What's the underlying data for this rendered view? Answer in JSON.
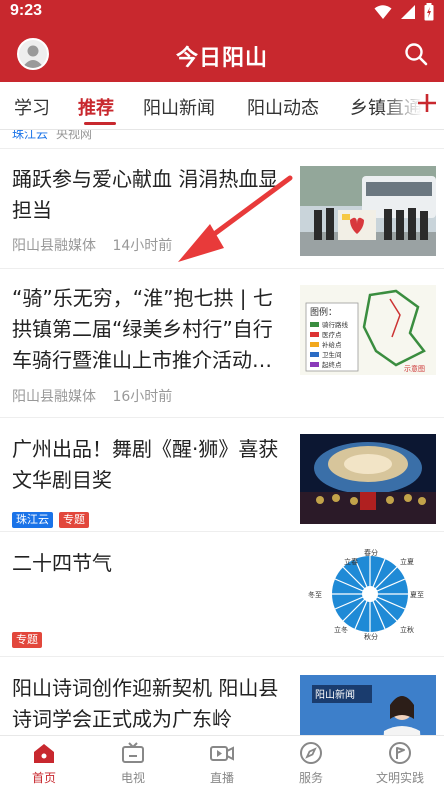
{
  "status": {
    "time": "9:23"
  },
  "header": {
    "title": "今日阳山"
  },
  "tabs": [
    {
      "label": "学习"
    },
    {
      "label": "推荐"
    },
    {
      "label": "阳山新闻"
    },
    {
      "label": "阳山动态"
    },
    {
      "label": "乡镇直通"
    }
  ],
  "cut_item": {
    "tag": "珠江云",
    "source": "央视网"
  },
  "articles": [
    {
      "title": "踊跃参与爱心献血 涓涓热血显担当",
      "source": "阳山县融媒体",
      "time": "14小时前"
    },
    {
      "title": "“骑”乐无穷，“淮”抱七拱 | 七拱镇第二届“绿美乡村行”自行车骑行暨淮山上市推介活动…",
      "source": "阳山县融媒体",
      "time": "16小时前",
      "map_legend": "图例：",
      "map_items": [
        "骑行路线",
        "医疗点",
        "补给点",
        "卫生间",
        "起终点"
      ],
      "map_label": "示意图"
    },
    {
      "title": "广州出品！舞剧《醒·狮》喜获文华剧目奖",
      "tags": [
        "珠江云",
        "专题"
      ]
    },
    {
      "title": "二十四节气",
      "tags": [
        "专题"
      ],
      "wheel_labels": [
        "立春",
        "立夏",
        "立秋",
        "立冬",
        "冬至",
        "夏至",
        "春分",
        "秋分"
      ]
    },
    {
      "title": "阳山诗词创作迎新契机 阳山县诗词学会正式成为广东岭",
      "caption": "阳山新闻"
    }
  ],
  "nav": [
    {
      "label": "首页"
    },
    {
      "label": "电视"
    },
    {
      "label": "直播"
    },
    {
      "label": "服务"
    },
    {
      "label": "文明实践"
    }
  ],
  "colors": {
    "brand": "#c8282e",
    "tag_blue": "#1a73e8",
    "tag_red": "#e2473c"
  }
}
